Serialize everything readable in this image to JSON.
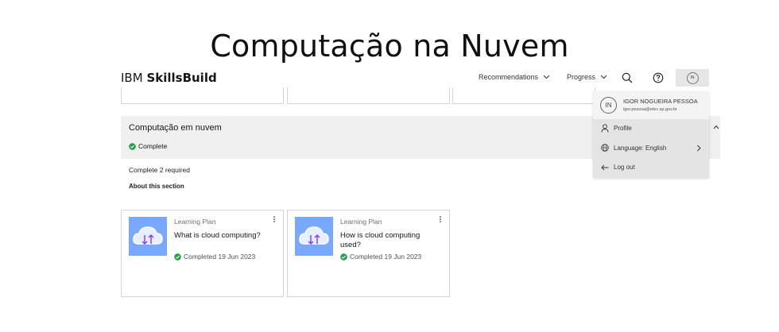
{
  "slide": {
    "title": "Computação na Nuvem"
  },
  "header": {
    "logo_ibm": "IBM",
    "logo_brand": "SkillsBuild",
    "nav": [
      {
        "label": "Recommendations"
      },
      {
        "label": "Progress"
      }
    ],
    "avatar_initials": "IN"
  },
  "section": {
    "title": "Computação em nuvem",
    "status": "Complete",
    "requirement": "Complete 2 required",
    "about": "About this section"
  },
  "cards": [
    {
      "type": "Learning Plan",
      "title": "What is cloud computing?",
      "completed": "Completed 19 Jun 2023"
    },
    {
      "type": "Learning Plan",
      "title": "How is cloud computing used?",
      "completed": "Completed 19 Jun 2023"
    }
  ],
  "dropdown": {
    "initials": "IN",
    "name": "IGOR NOGUEIRA PESSOA",
    "email": "igor.pessoa@etec.sp.gov.br",
    "items": [
      {
        "label": "Profile"
      },
      {
        "label": "Language: English"
      },
      {
        "label": "Log out"
      }
    ]
  },
  "colors": {
    "accent_blue": "#78a9ff",
    "success_green": "#24a148",
    "band_grey": "#f0f0f0"
  }
}
